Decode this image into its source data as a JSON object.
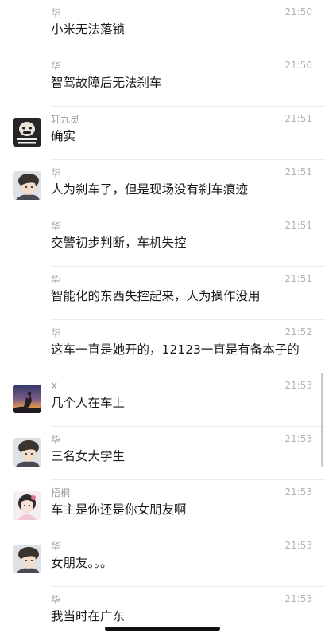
{
  "messages": [
    {
      "name": "华",
      "time": "21:50",
      "text": "小米无法落锁",
      "avatar": ""
    },
    {
      "name": "华",
      "time": "21:50",
      "text": "智驾故障后无法刹车",
      "avatar": ""
    },
    {
      "name": "轩九灵",
      "time": "21:51",
      "text": "确实",
      "avatar": "xuan-avatar"
    },
    {
      "name": "华",
      "time": "21:51",
      "text": "人为刹车了，但是现场没有刹车痕迹",
      "avatar": "hua-avatar"
    },
    {
      "name": "华",
      "time": "21:51",
      "text": "交警初步判断，车机失控",
      "avatar": ""
    },
    {
      "name": "华",
      "time": "21:51",
      "text": "智能化的东西失控起来，人为操作没用",
      "avatar": ""
    },
    {
      "name": "华",
      "time": "21:52",
      "text": "这车一直是她开的，12123一直是有备本子的",
      "avatar": ""
    },
    {
      "name": "X",
      "time": "21:53",
      "text": "几个人在车上",
      "avatar": "x-avatar"
    },
    {
      "name": "华",
      "time": "21:53",
      "text": "三名女大学生",
      "avatar": "hua-avatar"
    },
    {
      "name": "梧桐",
      "time": "21:53",
      "text": "车主是你还是你女朋友啊",
      "avatar": "wutong-avatar"
    },
    {
      "name": "华",
      "time": "21:53",
      "text": "女朋友。。。",
      "avatar": "hua-avatar"
    },
    {
      "name": "华",
      "time": "21:53",
      "text": "我当时在广东",
      "avatar": ""
    }
  ]
}
